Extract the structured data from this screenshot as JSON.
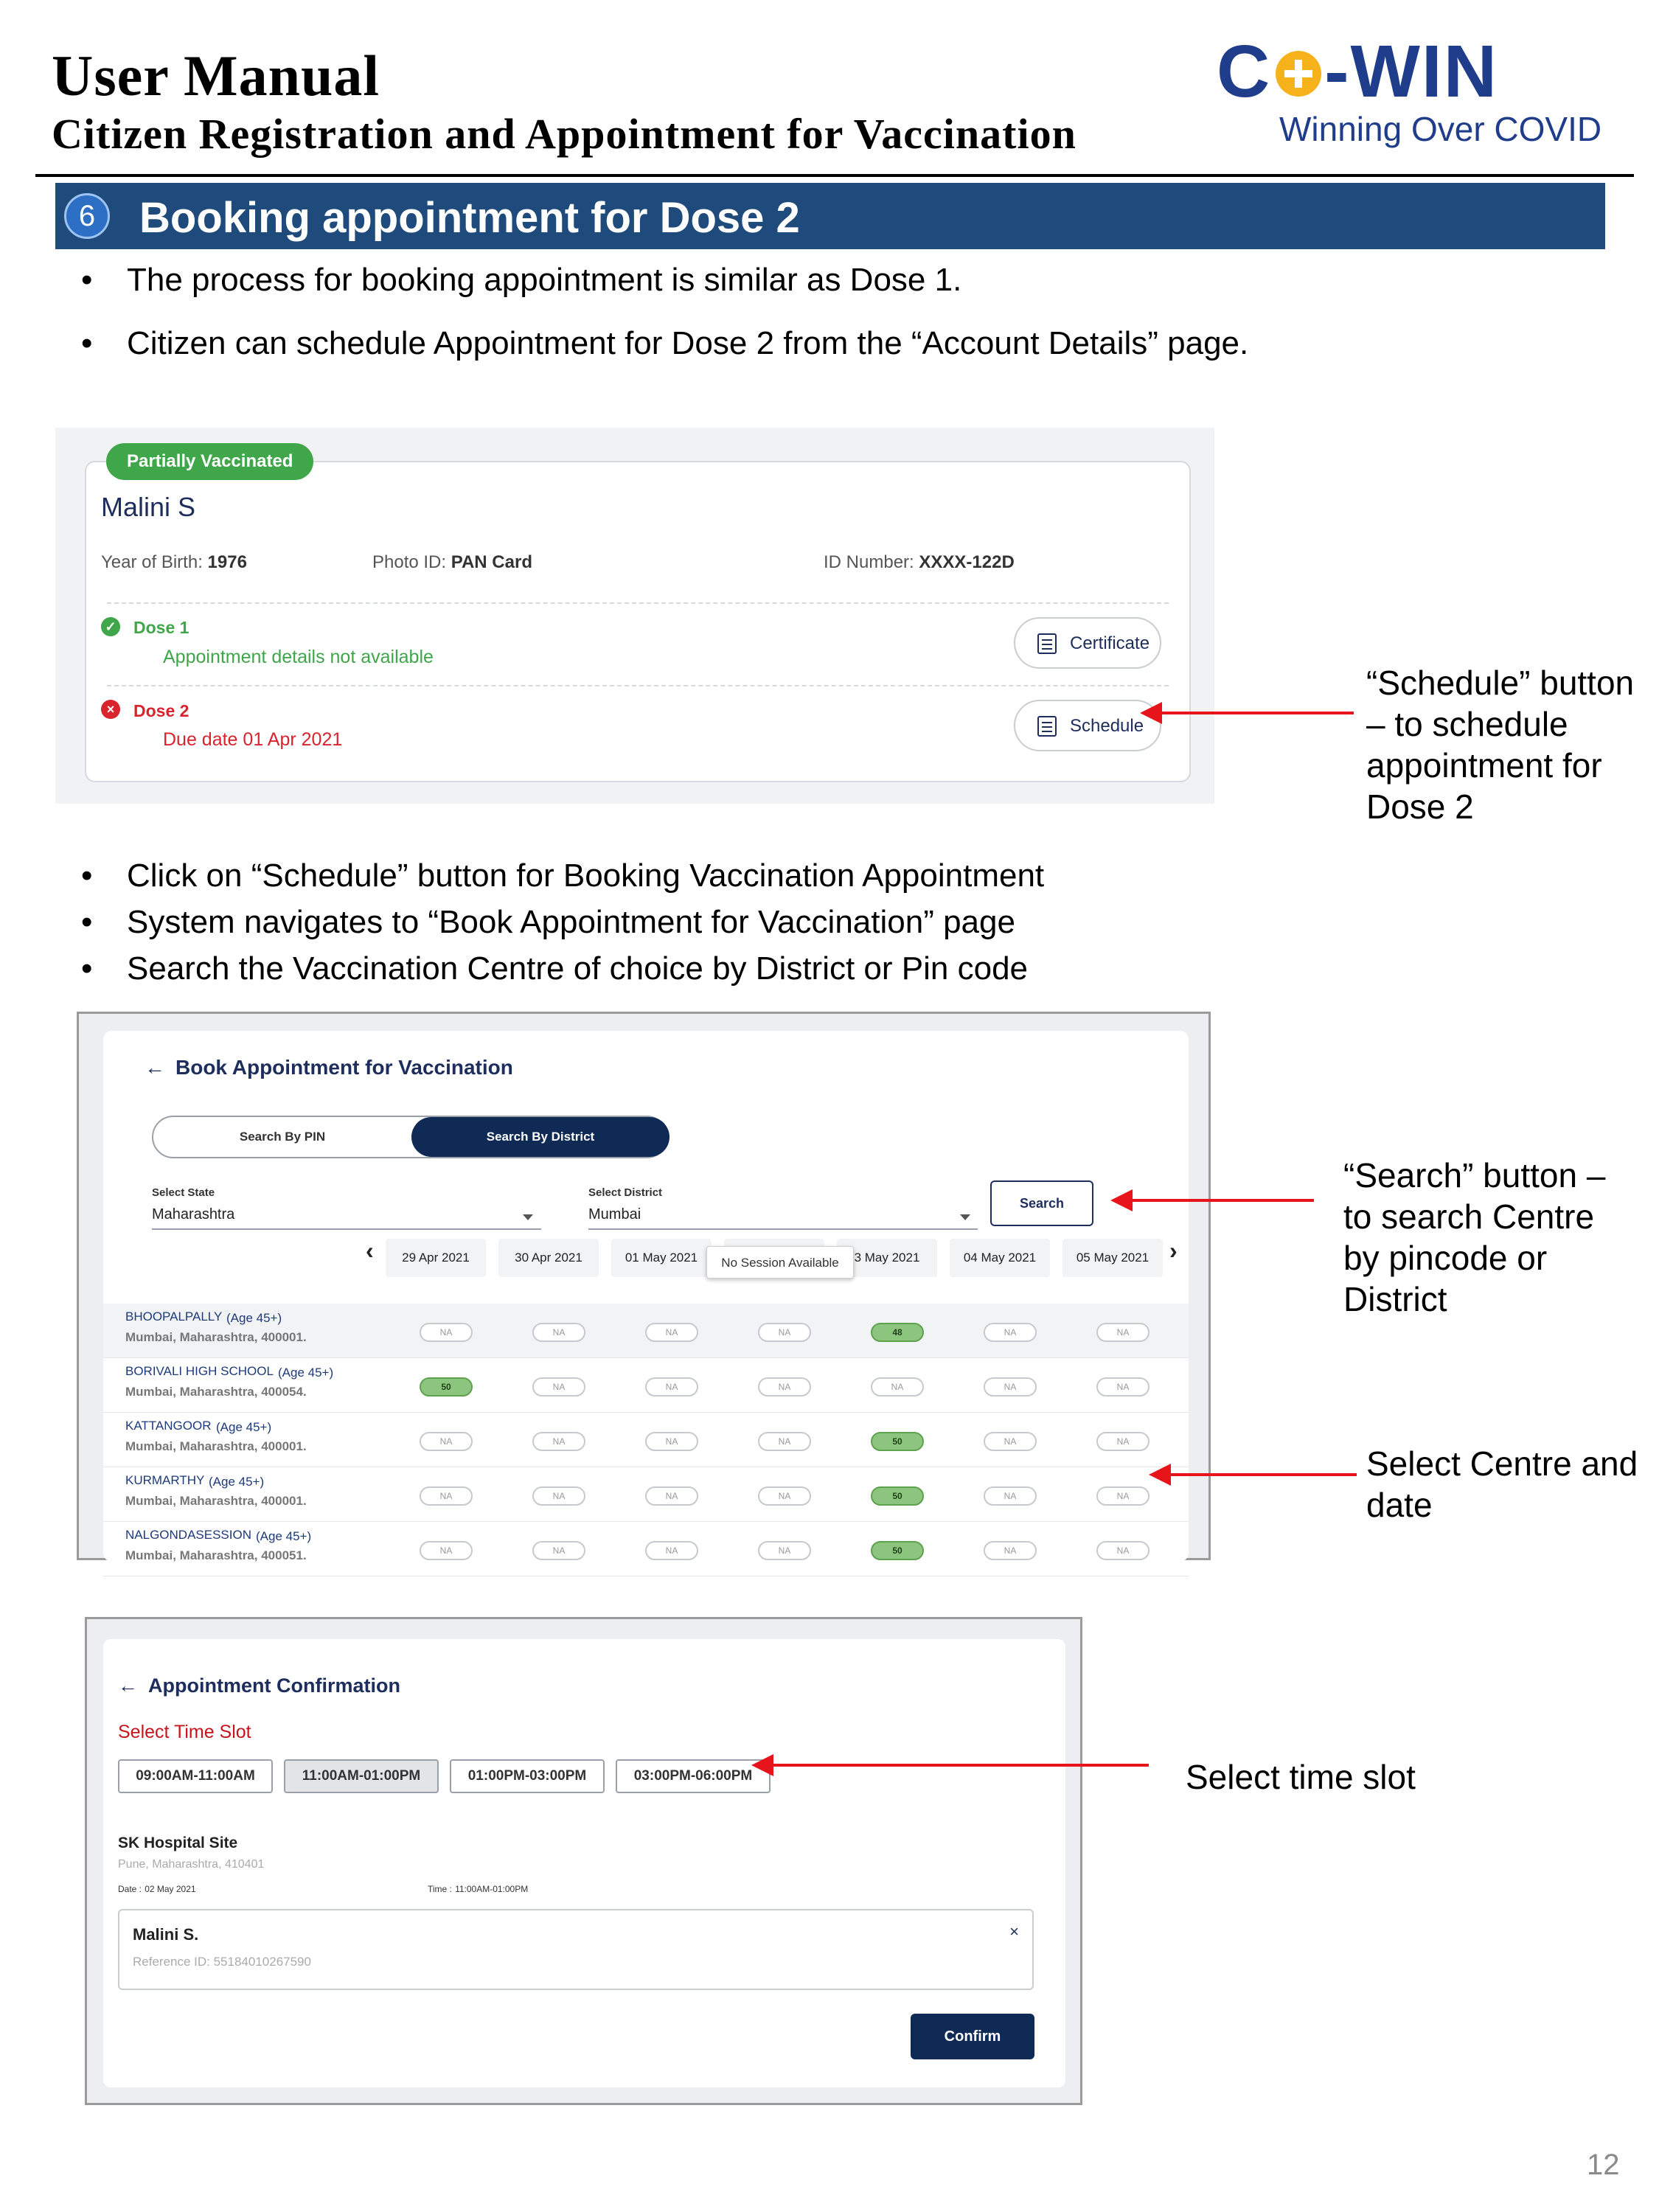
{
  "header": {
    "title": "User Manual",
    "subtitle": "Citizen Registration and Appointment for Vaccination",
    "logo": {
      "prefix": "C",
      "suffix": "-WIN",
      "tagline": "Winning Over COVID",
      "primary_color": "#1f3d8a",
      "accent_color": "#f5b21a"
    }
  },
  "section": {
    "number": "6",
    "title": "Booking appointment for Dose 2",
    "bar_color": "#1f4a7c"
  },
  "bullets_top": [
    "The process for booking appointment is similar as Dose 1.",
    "Citizen can schedule Appointment for Dose 2 from the “Account Details” page."
  ],
  "bullets_mid": [
    "Click on “Schedule” button for Booking Vaccination Appointment",
    "System navigates to “Book Appointment for Vaccination” page",
    "Search the Vaccination Centre of choice by District or Pin code"
  ],
  "annotations": {
    "schedule": [
      "“Schedule” button",
      "– to   schedule",
      "appointment for",
      "Dose 2"
    ],
    "search": [
      "“Search” button –",
      "to   search Centre",
      "by pincode or",
      "District"
    ],
    "select_centre": [
      "Select Centre and",
      "date"
    ],
    "time_slot": [
      "Select time slot"
    ],
    "arrow_color": "#e8141b"
  },
  "account": {
    "status_badge": "Partially Vaccinated",
    "name": "Malini S",
    "yob_label": "Year of Birth:",
    "yob": "1976",
    "photo_id_label": "Photo ID:",
    "photo_id": "PAN Card",
    "id_number_label": "ID Number:",
    "id_number": "XXXX-122D",
    "dose1": {
      "title": "Dose 1",
      "detail": "Appointment details not available",
      "button": "Certificate",
      "icon": "check-icon",
      "color": "#3fa64a"
    },
    "dose2": {
      "title": "Dose 2",
      "detail": "Due date 01 Apr 2021",
      "button": "Schedule",
      "icon": "error-icon",
      "color": "#d9232d"
    }
  },
  "book": {
    "title": "Book Appointment for Vaccination",
    "tabs": [
      "Search By PIN",
      "Search By District"
    ],
    "active_tab": "Search By District",
    "state_label": "Select State",
    "state_value": "Maharashtra",
    "district_label": "Select District",
    "district_value": "Mumbai",
    "search_button": "Search",
    "dates": [
      "29 Apr 2021",
      "30 Apr 2021",
      "01 May 2021",
      "02 May 2021",
      "3 May 2021",
      "04 May 2021",
      "05 May 2021"
    ],
    "tooltip": "No Session Available",
    "centers": [
      {
        "name": "BHOOPALPALLY",
        "age": "(Age 45+)",
        "address": "Mumbai, Maharashtra, 400001.",
        "slots": [
          "NA",
          "NA",
          "NA",
          "NA",
          "48",
          "NA",
          "NA"
        ]
      },
      {
        "name": "BORIVALI HIGH SCHOOL",
        "age": "(Age 45+)",
        "address": "Mumbai, Maharashtra, 400054.",
        "slots": [
          "50",
          "NA",
          "NA",
          "NA",
          "NA",
          "NA",
          "NA"
        ]
      },
      {
        "name": "KATTANGOOR",
        "age": "(Age 45+)",
        "address": "Mumbai, Maharashtra, 400001.",
        "slots": [
          "NA",
          "NA",
          "NA",
          "NA",
          "50",
          "NA",
          "NA"
        ]
      },
      {
        "name": "KURMARTHY",
        "age": "(Age 45+)",
        "address": "Mumbai, Maharashtra, 400001.",
        "slots": [
          "NA",
          "NA",
          "NA",
          "NA",
          "50",
          "NA",
          "NA"
        ]
      },
      {
        "name": "NALGONDASESSION",
        "age": "(Age 45+)",
        "address": "Mumbai, Maharashtra, 400051.",
        "slots": [
          "NA",
          "NA",
          "NA",
          "NA",
          "50",
          "NA",
          "NA"
        ]
      }
    ]
  },
  "confirm": {
    "title": "Appointment Confirmation",
    "slot_label": "Select Time Slot",
    "slots": [
      "09:00AM-11:00AM",
      "11:00AM-01:00PM",
      "01:00PM-03:00PM",
      "03:00PM-06:00PM"
    ],
    "selected_slot": "11:00AM-01:00PM",
    "site_name": "SK Hospital Site",
    "site_address": "Pune, Maharashtra, 410401",
    "date_label": "Date :",
    "date_value": "02 May 2021",
    "time_label": "Time :",
    "time_value": "11:00AM-01:00PM",
    "person_name": "Malini S.",
    "reference": "Reference ID: 55184010267590",
    "close_symbol": "×",
    "confirm_button": "Confirm"
  },
  "page_number": "12"
}
